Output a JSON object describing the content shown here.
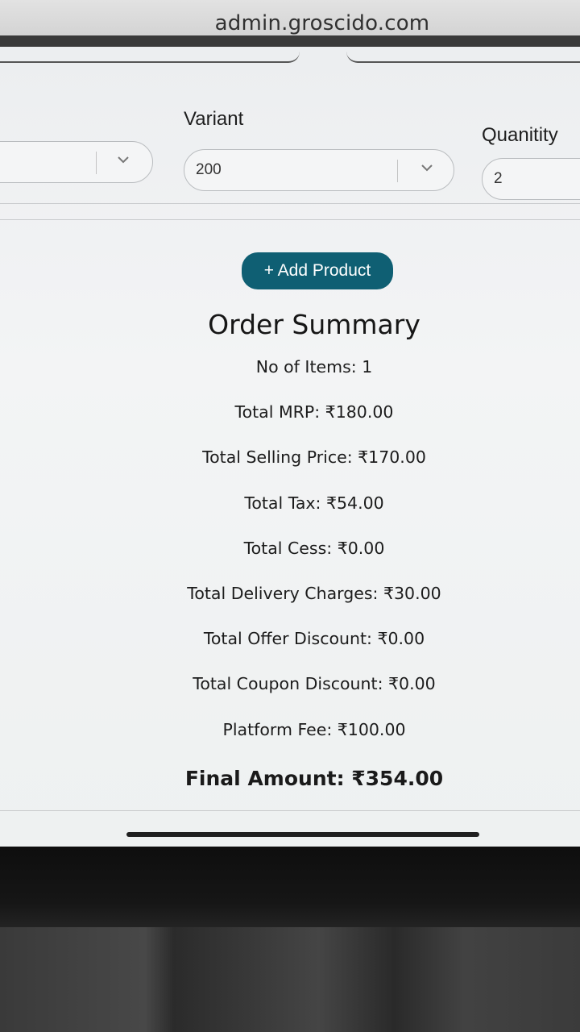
{
  "browser": {
    "url": "admin.groscido.com"
  },
  "form": {
    "variant_label": "Variant",
    "variant_value": "200",
    "quantity_label": "Quanitity",
    "quantity_value": "2"
  },
  "actions": {
    "add_product_label": "+ Add Product"
  },
  "summary": {
    "title": "Order Summary",
    "lines": [
      "No of Items: 1",
      "Total MRP: ₹180.00",
      "Total Selling Price: ₹170.00",
      "Total Tax: ₹54.00",
      "Total Cess: ₹0.00",
      "Total Delivery Charges: ₹30.00",
      "Total Offer Discount: ₹0.00",
      "Total Coupon Discount: ₹0.00",
      "Platform Fee: ₹100.00"
    ],
    "final_amount": "Final Amount: ₹354.00"
  },
  "colors": {
    "primary_button": "#0f5f73"
  }
}
